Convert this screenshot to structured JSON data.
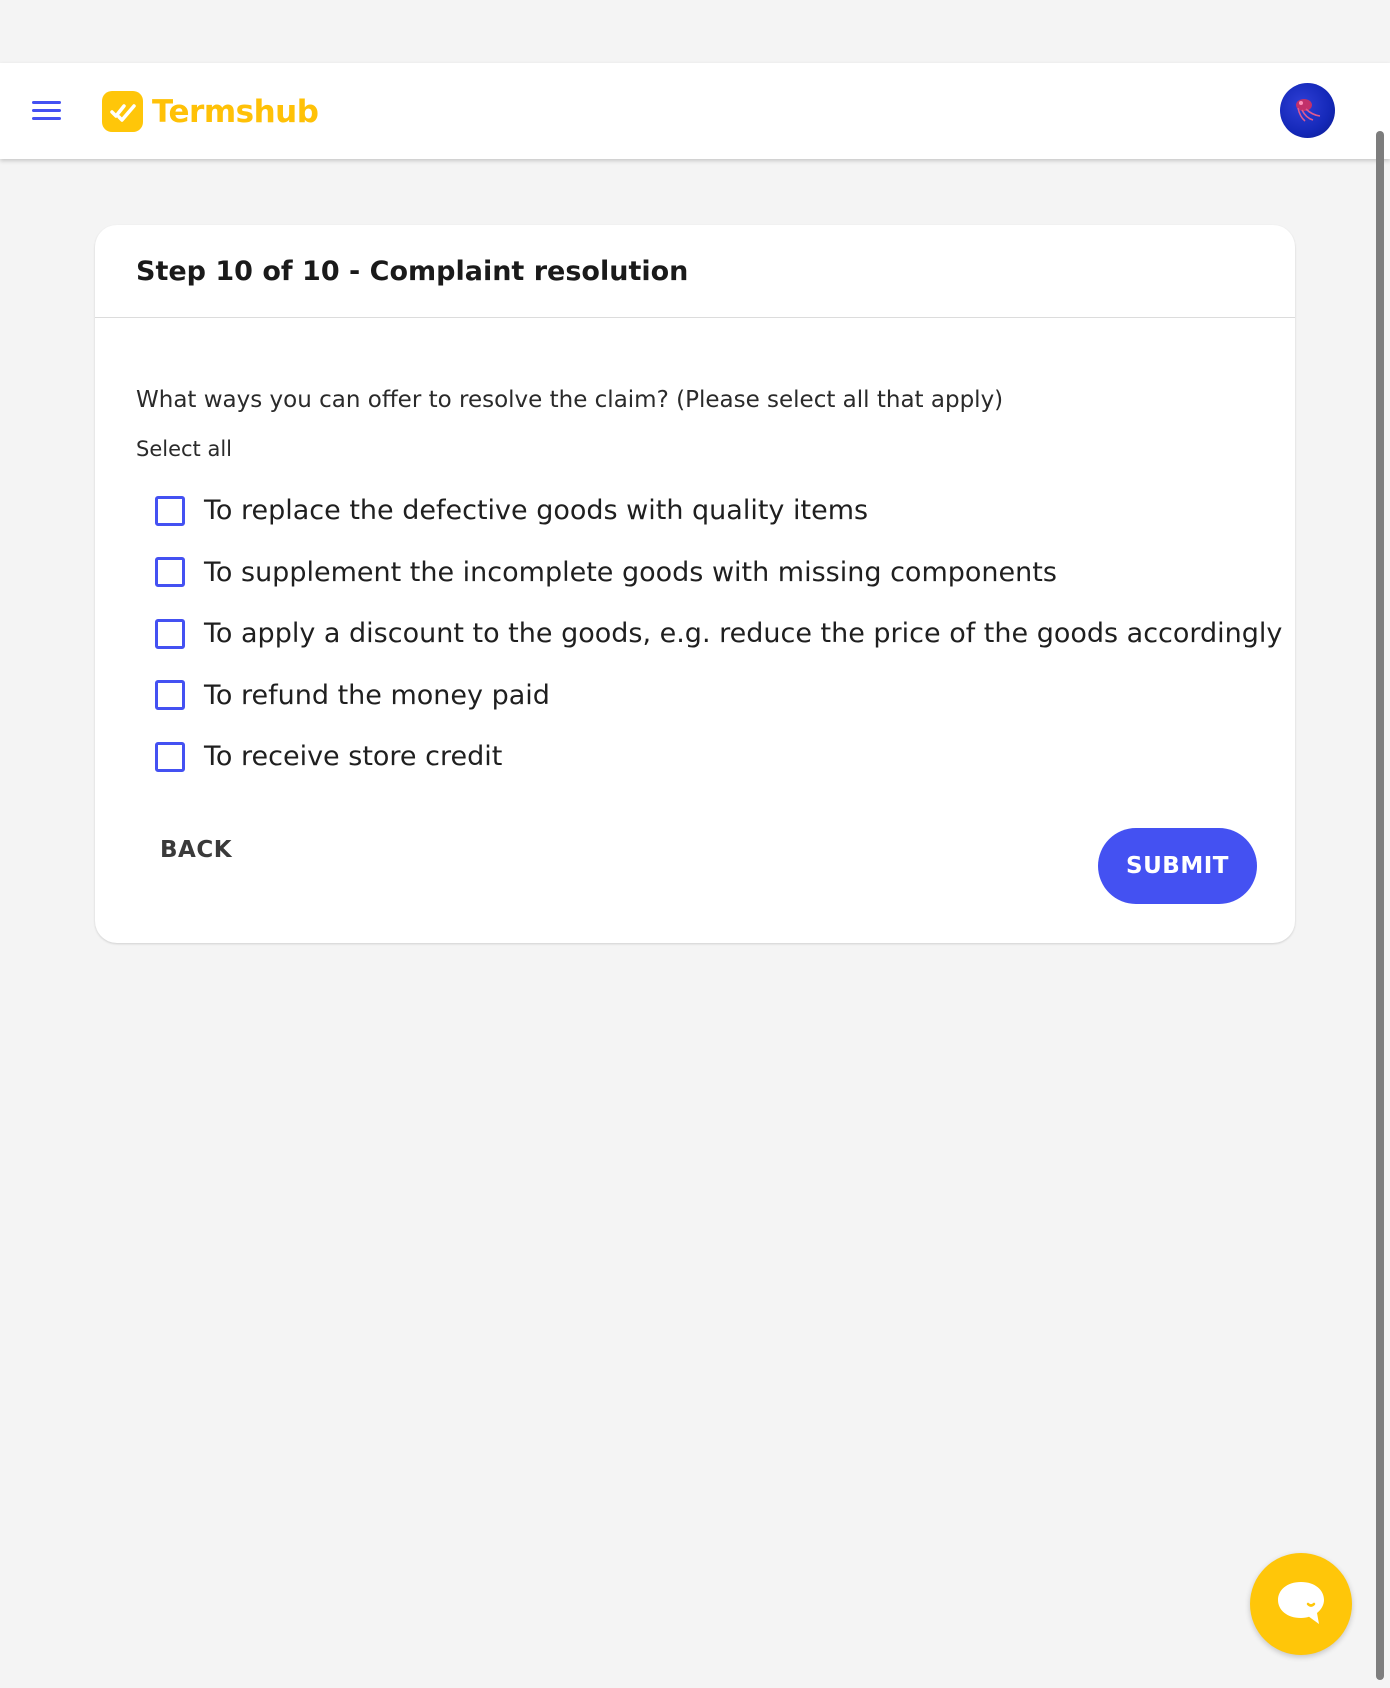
{
  "header": {
    "brand": "Termshub",
    "colors": {
      "brand": "#ffc107",
      "accent": "#4451f2"
    },
    "icons": {
      "menu": "hamburger-menu-icon",
      "logo": "termshub-logo-icon",
      "avatar": "user-avatar"
    }
  },
  "form": {
    "title": "Step 10 of 10 - Complaint resolution",
    "question": "What ways you can offer to resolve the claim? (Please select all that apply)",
    "select_all_label": "Select all",
    "options": [
      {
        "label": "To replace the defective goods with quality items",
        "checked": false
      },
      {
        "label": "To supplement the incomplete goods with missing components",
        "checked": false
      },
      {
        "label": "To apply a discount to the goods, e.g. reduce the price of the goods accordingly",
        "checked": false
      },
      {
        "label": "To refund the money paid",
        "checked": false
      },
      {
        "label": "To receive store credit",
        "checked": false
      }
    ],
    "back_label": "BACK",
    "submit_label": "SUBMIT"
  },
  "chat": {
    "icon": "chat-bubble-icon",
    "color": "#ffc609"
  }
}
